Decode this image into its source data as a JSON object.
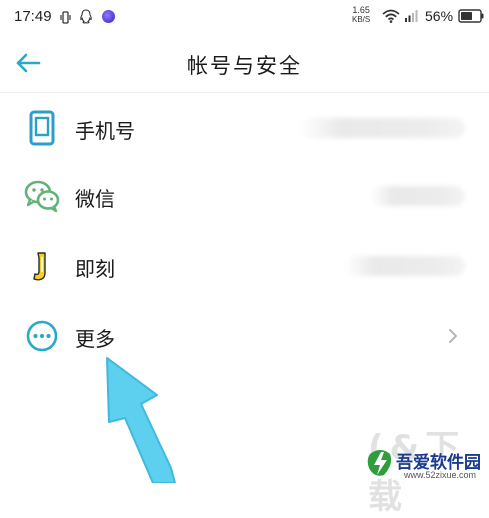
{
  "status_bar": {
    "time": "17:49",
    "net_speed_value": "1.65",
    "net_speed_unit": "KB/S",
    "battery_percent": "56%",
    "icons": [
      "vibrate-icon",
      "qq-icon",
      "app-dot-icon",
      "wifi-icon",
      "signal-icon",
      "battery-icon"
    ]
  },
  "header": {
    "title": "帐号与安全",
    "back_icon": "arrow-left-icon"
  },
  "list": {
    "items": [
      {
        "label": "手机号",
        "icon": "phone-icon",
        "value_blurred": true
      },
      {
        "label": "微信",
        "icon": "wechat-icon",
        "value_blurred": true
      },
      {
        "label": "即刻",
        "icon": "jike-icon",
        "value_blurred": true
      },
      {
        "label": "更多",
        "icon": "more-icon",
        "trailing": "chevron-right-icon"
      }
    ]
  },
  "watermark": {
    "ghost_text": "(&下载",
    "title": "吾爱软件园",
    "url": "www.52zixue.com"
  },
  "colors": {
    "accent": "#2aa7c9",
    "arrow": "#5dd0ef",
    "wechat": "#63b174",
    "jike": "#f5d21f",
    "phone_icon": "#2b9fc9"
  }
}
